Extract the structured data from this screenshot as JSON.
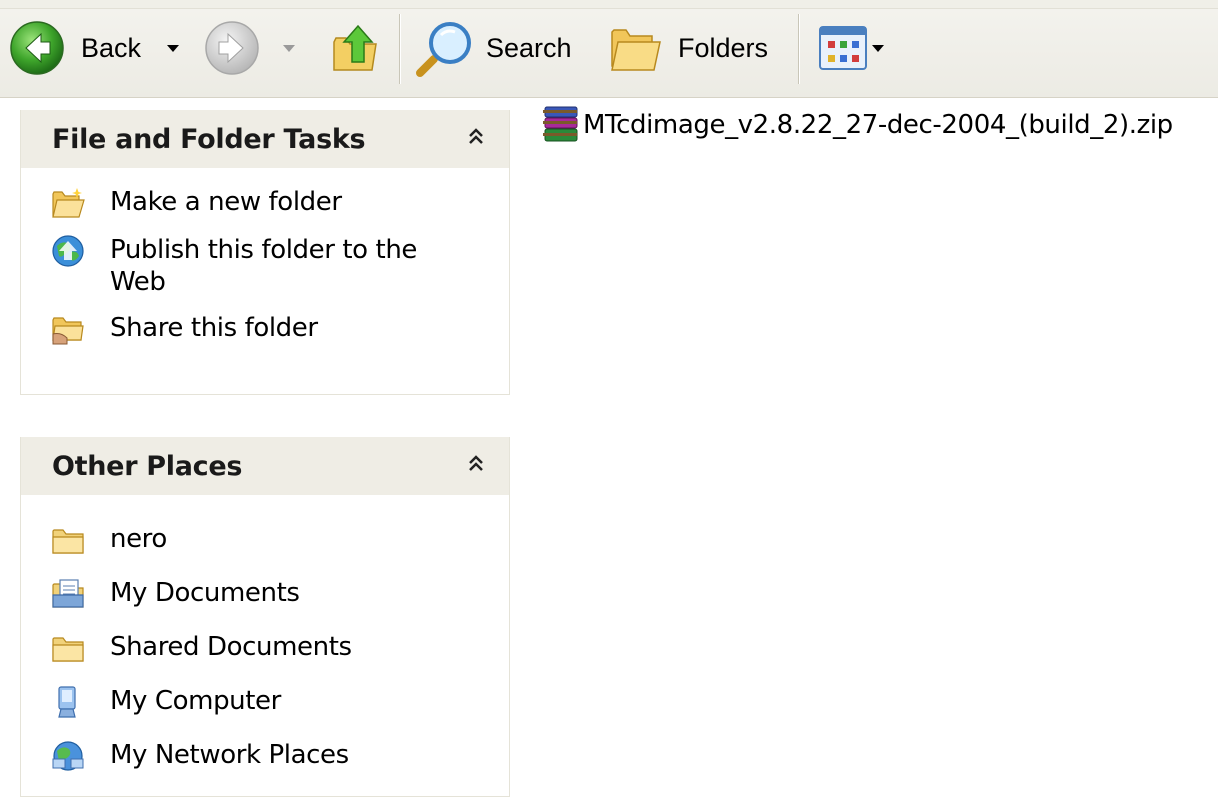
{
  "toolbar": {
    "back_label": "Back",
    "search_label": "Search",
    "folders_label": "Folders"
  },
  "file_and_folder_tasks": {
    "title": "File and Folder Tasks",
    "items": [
      {
        "label": "Make a new folder",
        "icon": "new-folder-icon"
      },
      {
        "label": "Publish this folder to the Web",
        "icon": "publish-web-icon"
      },
      {
        "label": "Share this folder",
        "icon": "share-folder-icon"
      }
    ]
  },
  "other_places": {
    "title": "Other Places",
    "items": [
      {
        "label": "nero",
        "icon": "folder-icon"
      },
      {
        "label": "My Documents",
        "icon": "my-documents-icon"
      },
      {
        "label": "Shared Documents",
        "icon": "folder-icon"
      },
      {
        "label": "My Computer",
        "icon": "my-computer-icon"
      },
      {
        "label": "My Network Places",
        "icon": "network-places-icon"
      }
    ]
  },
  "files": [
    {
      "name": "MTcdimage_v2.8.22_27-dec-2004_(build_2).zip",
      "icon": "winrar-archive-icon"
    }
  ],
  "colors": {
    "pane_header": "#efede5",
    "toolbar": "#ecebe4"
  }
}
